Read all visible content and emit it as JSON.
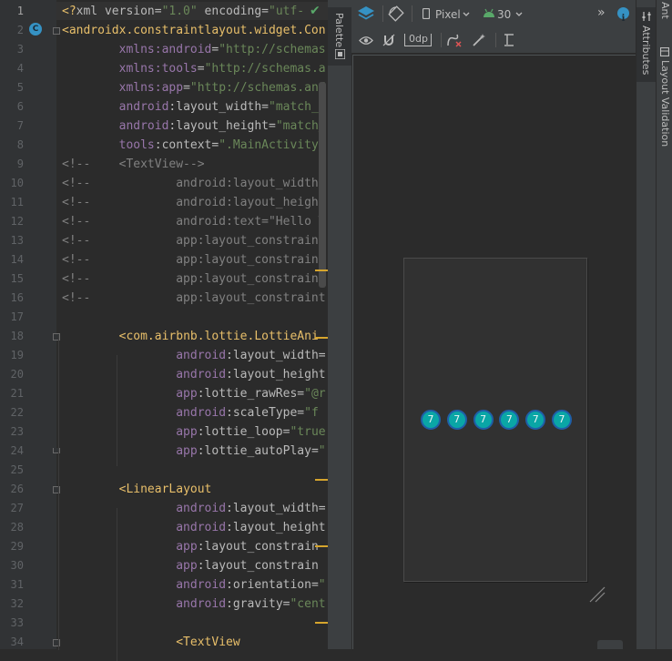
{
  "editor": {
    "line_numbers": [
      "1",
      "2",
      "3",
      "4",
      "5",
      "6",
      "7",
      "8",
      "9",
      "10",
      "11",
      "12",
      "13",
      "14",
      "15",
      "16",
      "17",
      "18",
      "19",
      "20",
      "21",
      "22",
      "23",
      "24",
      "25",
      "26",
      "27",
      "28",
      "29",
      "30",
      "31",
      "32",
      "33",
      "34"
    ],
    "class_marker": "C",
    "check_glyph": "✔",
    "lines": [
      [
        {
          "s": "<?",
          "k": "t"
        },
        {
          "s": "xml version=",
          "k": "n"
        },
        {
          "s": "\"1.0\"",
          "k": "v"
        },
        {
          "s": " encoding=",
          "k": "n"
        },
        {
          "s": "\"utf-",
          "k": "v"
        }
      ],
      [
        {
          "s": "<androidx.constraintlayout.widget.Con",
          "k": "t"
        }
      ],
      [
        {
          "s": "        "
        },
        {
          "s": "xmlns:",
          "k": "a"
        },
        {
          "s": "android",
          "k": "a"
        },
        {
          "s": "=",
          "k": "n"
        },
        {
          "s": "\"http://schemas",
          "k": "v"
        }
      ],
      [
        {
          "s": "        "
        },
        {
          "s": "xmlns:",
          "k": "a"
        },
        {
          "s": "tools",
          "k": "a"
        },
        {
          "s": "=",
          "k": "n"
        },
        {
          "s": "\"http://schemas.a",
          "k": "v"
        }
      ],
      [
        {
          "s": "        "
        },
        {
          "s": "xmlns:",
          "k": "a"
        },
        {
          "s": "app",
          "k": "a"
        },
        {
          "s": "=",
          "k": "n"
        },
        {
          "s": "\"http://schemas.and",
          "k": "v"
        }
      ],
      [
        {
          "s": "        "
        },
        {
          "s": "android",
          "k": "a"
        },
        {
          "s": ":layout_width=",
          "k": "n"
        },
        {
          "s": "\"match_p",
          "k": "v"
        }
      ],
      [
        {
          "s": "        "
        },
        {
          "s": "android",
          "k": "a"
        },
        {
          "s": ":layout_height=",
          "k": "n"
        },
        {
          "s": "\"match_",
          "k": "v"
        }
      ],
      [
        {
          "s": "        "
        },
        {
          "s": "tools",
          "k": "a"
        },
        {
          "s": ":context=",
          "k": "n"
        },
        {
          "s": "\".MainActivity\"",
          "k": "v"
        }
      ],
      [
        {
          "s": "<!--    <TextView-->",
          "k": "c"
        }
      ],
      [
        {
          "s": "<!--            android:layout_width=",
          "k": "c"
        }
      ],
      [
        {
          "s": "<!--            android:layout_height",
          "k": "c"
        }
      ],
      [
        {
          "s": "<!--            android:text=\"Hello W",
          "k": "c"
        }
      ],
      [
        {
          "s": "<!--            app:layout_constraint",
          "k": "c"
        }
      ],
      [
        {
          "s": "<!--            app:layout_constraint",
          "k": "c"
        }
      ],
      [
        {
          "s": "<!--            app:layout_constrain",
          "k": "c"
        }
      ],
      [
        {
          "s": "<!--            app:layout_constraint",
          "k": "c"
        }
      ],
      [
        {
          "s": ""
        }
      ],
      [
        {
          "s": "        "
        },
        {
          "s": "<com.airbnb.lottie.LottieAni",
          "k": "t"
        }
      ],
      [
        {
          "s": "                "
        },
        {
          "s": "android",
          "k": "a"
        },
        {
          "s": ":layout_width=",
          "k": "n"
        }
      ],
      [
        {
          "s": "                "
        },
        {
          "s": "android",
          "k": "a"
        },
        {
          "s": ":layout_height",
          "k": "n"
        }
      ],
      [
        {
          "s": "                "
        },
        {
          "s": "app",
          "k": "a"
        },
        {
          "s": ":lottie_rawRes=",
          "k": "n"
        },
        {
          "s": "\"@r",
          "k": "v"
        }
      ],
      [
        {
          "s": "                "
        },
        {
          "s": "android",
          "k": "a"
        },
        {
          "s": ":scaleType=",
          "k": "n"
        },
        {
          "s": "\"f",
          "k": "v"
        }
      ],
      [
        {
          "s": "                "
        },
        {
          "s": "app",
          "k": "a"
        },
        {
          "s": ":lottie_loop=",
          "k": "n"
        },
        {
          "s": "\"true",
          "k": "v"
        }
      ],
      [
        {
          "s": "                "
        },
        {
          "s": "app",
          "k": "a"
        },
        {
          "s": ":lottie_autoPlay=",
          "k": "n"
        },
        {
          "s": "\"",
          "k": "v"
        }
      ],
      [
        {
          "s": ""
        }
      ],
      [
        {
          "s": "        "
        },
        {
          "s": "<LinearLayout",
          "k": "t"
        }
      ],
      [
        {
          "s": "                "
        },
        {
          "s": "android",
          "k": "a"
        },
        {
          "s": ":layout_width=",
          "k": "n"
        }
      ],
      [
        {
          "s": "                "
        },
        {
          "s": "android",
          "k": "a"
        },
        {
          "s": ":layout_height",
          "k": "n"
        }
      ],
      [
        {
          "s": "                "
        },
        {
          "s": "app",
          "k": "a"
        },
        {
          "s": ":layout_constrain",
          "k": "n"
        }
      ],
      [
        {
          "s": "                "
        },
        {
          "s": "app",
          "k": "a"
        },
        {
          "s": ":layout_constrain",
          "k": "n"
        }
      ],
      [
        {
          "s": "                "
        },
        {
          "s": "android",
          "k": "a"
        },
        {
          "s": ":orientation=",
          "k": "n"
        },
        {
          "s": "\"",
          "k": "v"
        }
      ],
      [
        {
          "s": "                "
        },
        {
          "s": "android",
          "k": "a"
        },
        {
          "s": ":gravity=",
          "k": "n"
        },
        {
          "s": "\"cent",
          "k": "v"
        }
      ],
      [
        {
          "s": ""
        }
      ],
      [
        {
          "s": "                "
        },
        {
          "s": "<TextView",
          "k": "t"
        }
      ]
    ]
  },
  "palette": {
    "label": "Palette"
  },
  "toolbar": {
    "device": "Pixel",
    "api_level": "30",
    "margin_value": "0dp",
    "overflow_glyph": "»",
    "info_glyph": "i"
  },
  "preview": {
    "badges": [
      "7",
      "7",
      "7",
      "7",
      "7",
      "7"
    ]
  },
  "side_tabs": {
    "attributes": "Attributes",
    "ant": "Ant",
    "layout_validation": "Layout Validation"
  },
  "colors": {
    "tag": "#e8bf6a",
    "attr": "#9876aa",
    "value": "#6a8759",
    "comment": "#808080",
    "badge_fill": "#0aa6a6",
    "badge_ring": "#1f5fa8",
    "accent_blue": "#3592c4"
  }
}
